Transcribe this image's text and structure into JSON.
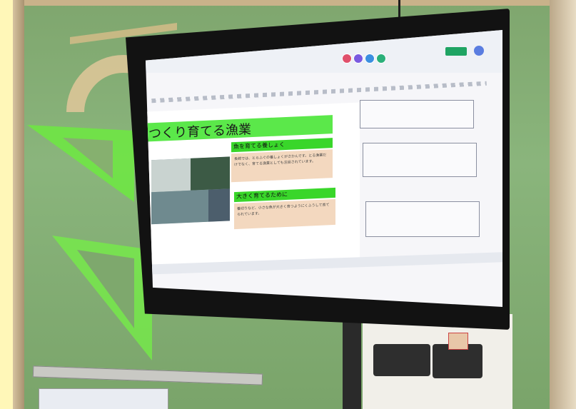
{
  "slide": {
    "title": "つくり育てる漁業",
    "subheading_1": "魚を育てる養しょく",
    "body_1": "長崎では、とらふぐの養しょくがさかんです。とる漁業だけでなく、育てる漁業としても注目されています。",
    "subheading_2": "大きく育てるために",
    "body_2": "養切りなど、小さな魚が大きく育つようにくふうして育てられています。"
  }
}
